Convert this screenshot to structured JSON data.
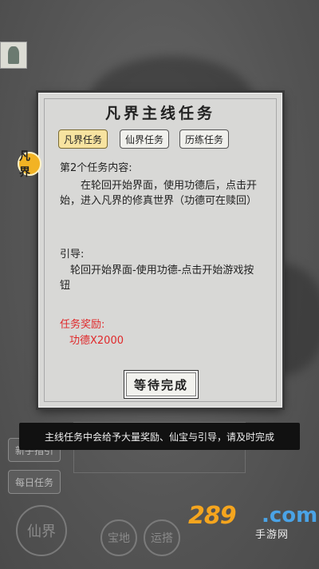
{
  "panel": {
    "title": "凡界主线任务",
    "tabs": [
      {
        "label": "凡界任务",
        "active": true
      },
      {
        "label": "仙界任务",
        "active": false
      },
      {
        "label": "历练任务",
        "active": false
      }
    ],
    "seal_text": "凡界",
    "task_heading": "第2个任务内容:",
    "task_body": "在轮回开始界面，使用功德后，点击开始，进入凡界的修真世界（功德可在赎回）",
    "guide_heading": "引导:",
    "guide_body": "轮回开始界面-使用功德-点击开始游戏按钮",
    "reward_heading": "任务奖励:",
    "reward_value": "功德X2000",
    "wait_button": "等待完成"
  },
  "toast": "主线任务中会给予大量奖励、仙宝与引导，请及时完成",
  "side": {
    "new_hand": "新手指引",
    "daily": "每日任务"
  },
  "bottom": {
    "xianjie": "仙界",
    "b1": "宝地",
    "b2": "运搭"
  },
  "watermark": {
    "number": "289",
    "domain": ".com",
    "sub": "手游网"
  },
  "colors": {
    "reward": "#e0282a",
    "active_tab": "#f7e3a0",
    "seal": "#f2b324"
  }
}
